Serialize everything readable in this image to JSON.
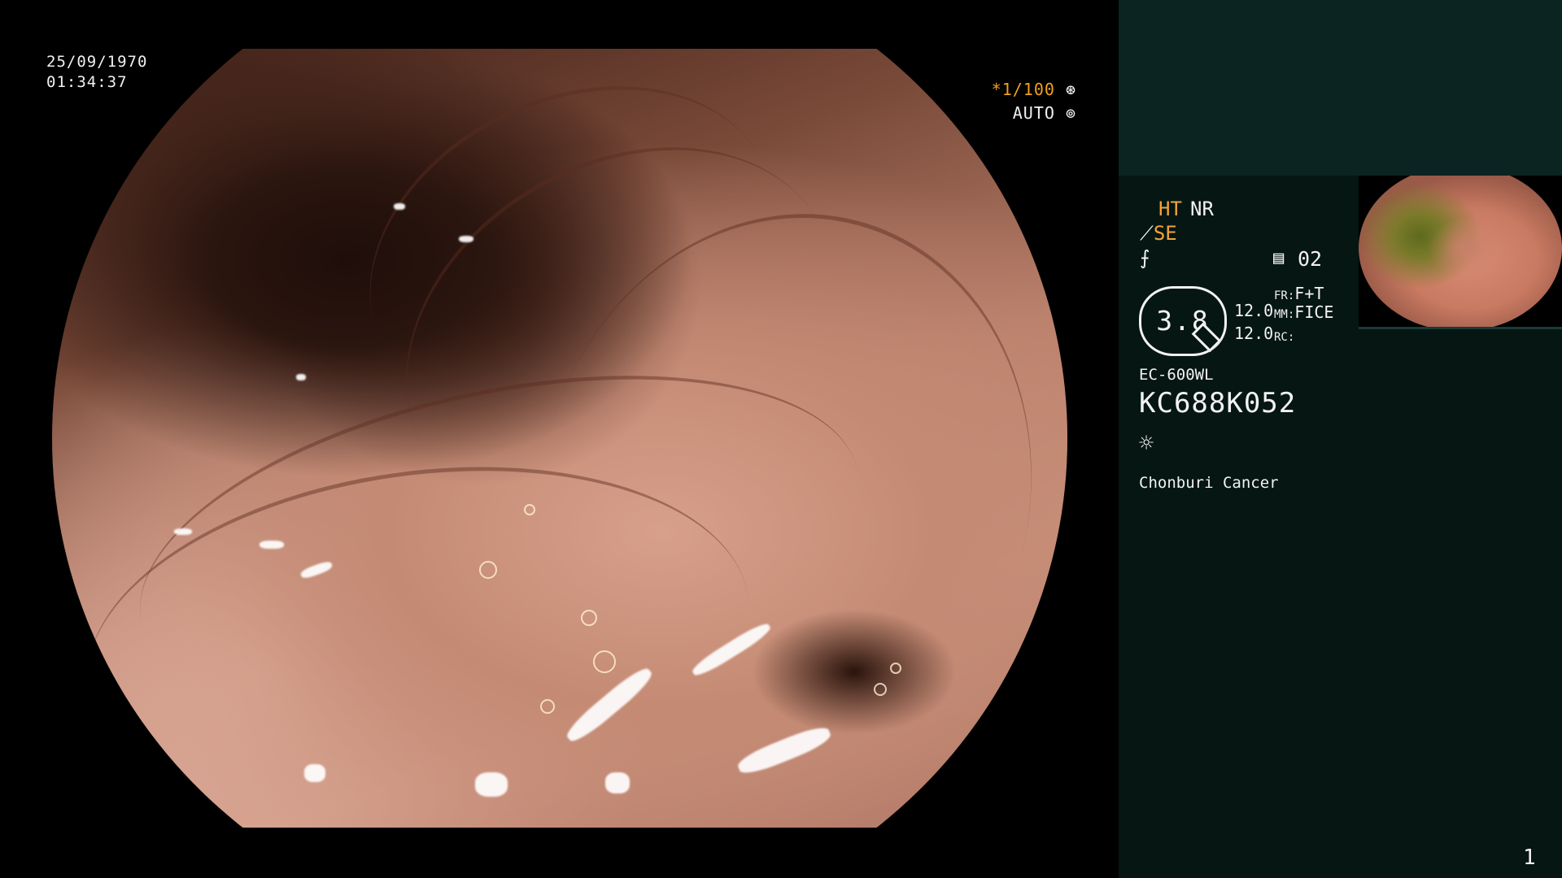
{
  "live_view": {
    "date": "25/09/1970",
    "time": "01:34:37",
    "shutter": "*1/100",
    "shutter_icon": "aperture-icon",
    "iris_mode": "AUTO",
    "iris_icon": "iris-icon"
  },
  "panel": {
    "ht_label": "HT",
    "nr_label": "NR",
    "se_label": "SE",
    "se_icon": "⟋",
    "enhance_icon": "⨍",
    "memory_icon": "▤",
    "memory_value": "02",
    "zoom_value": "3.8",
    "value_top": "12.0",
    "value_bottom": "12.0",
    "fr_key": "FR:",
    "fr_value": "F+T",
    "mm_key": "MM:",
    "mm_value": "FICE",
    "rc_key": "RC:",
    "rc_value": "",
    "scope_model": "EC-600WL",
    "scope_serial": "KC688K052",
    "light_icon": "☼",
    "institution": "Chonburi Cancer",
    "page_number": "1"
  },
  "colors": {
    "accent_orange": "#f2a43a",
    "panel_bg": "#061612",
    "panel_top_bg": "#0b2421"
  }
}
